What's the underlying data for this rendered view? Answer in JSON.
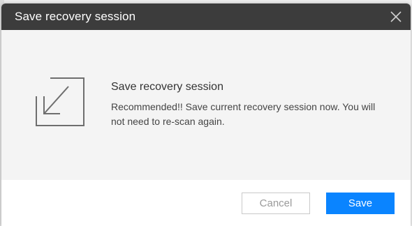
{
  "dialog": {
    "title": "Save recovery session",
    "close_icon": "close-icon"
  },
  "message": {
    "icon": "save-download-icon",
    "heading": "Save recovery session",
    "body": "Recommended!! Save current recovery session now. You will not need to re-scan again."
  },
  "buttons": {
    "cancel_label": "Cancel",
    "save_label": "Save"
  },
  "colors": {
    "titlebar": "#3c3c3c",
    "accent": "#0a84ff",
    "content_bg": "#f4f4f4"
  }
}
